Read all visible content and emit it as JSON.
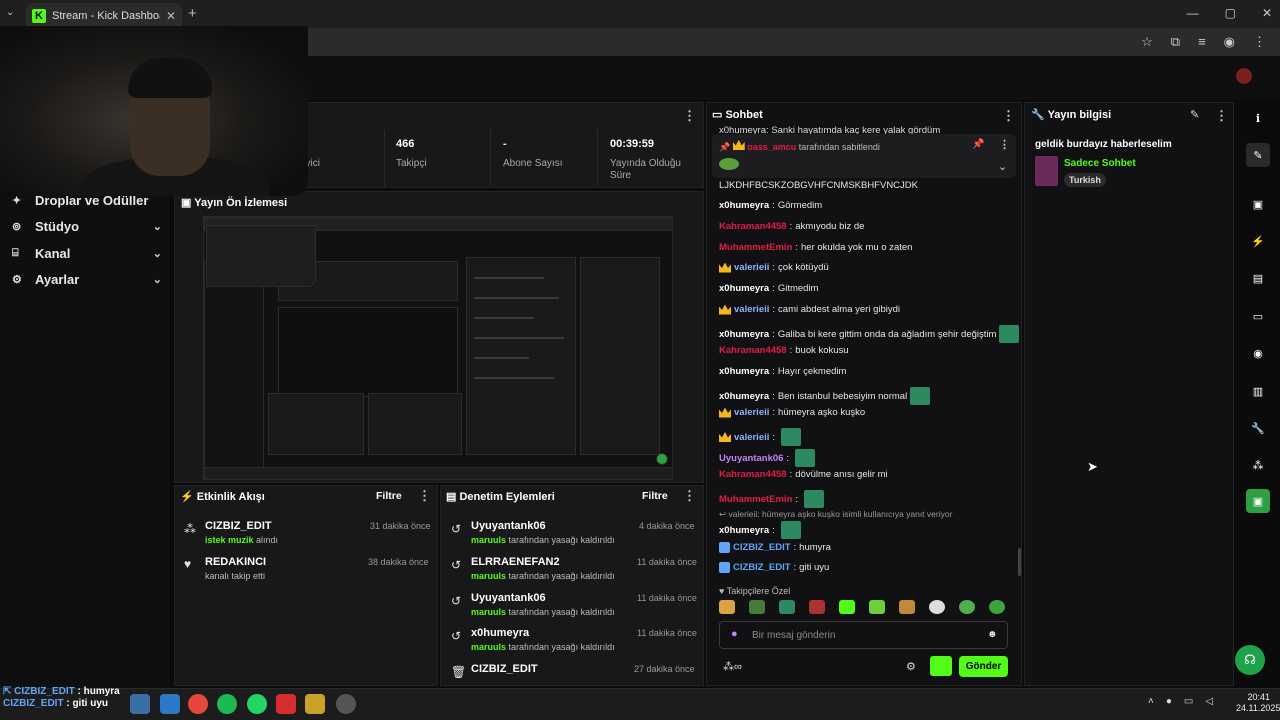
{
  "browser": {
    "tab_title": "Stream - Kick Dashboard",
    "new_tab": "+",
    "close_tab": "✕",
    "window_controls": [
      "—",
      "▢",
      "✕"
    ]
  },
  "sidebar": {
    "items": [
      {
        "label": "Droplar ve Ödüller",
        "icon": "gift-icon"
      },
      {
        "label": "Stüdyo",
        "icon": "studio-icon"
      },
      {
        "label": "Kanal",
        "icon": "channel-icon"
      },
      {
        "label": "Ayarlar",
        "icon": "gear-icon"
      }
    ]
  },
  "stats": {
    "viewers_label": "İzleyici",
    "followers_value": "466",
    "followers_label": "Takipçi",
    "subs_value": "-",
    "subs_label": "Abone Sayısı",
    "uptime_value": "00:39:59",
    "uptime_label": "Yayında Olduğu Süre"
  },
  "preview": {
    "title": "Yayın Ön İzlemesi"
  },
  "activity": {
    "title": "Etkinlik Akışı",
    "filter": "Filtre",
    "items": [
      {
        "name": "CIZBIZ_EDIT",
        "highlight": "istek muzik",
        "rest": " alındı",
        "ago": "31 dakika önce"
      },
      {
        "name": "REDAKINCI",
        "highlight": "",
        "rest": "kanalı takip etti",
        "ago": "38 dakika önce"
      }
    ]
  },
  "moderation": {
    "title": "Denetim Eylemleri",
    "filter": "Filtre",
    "items": [
      {
        "name": "Uyuyantank06",
        "by": "maruuls",
        "action": " tarafından yasağı kaldırıldı",
        "ago": "4 dakika önce"
      },
      {
        "name": "ELRRAENEFAN2",
        "by": "maruuls",
        "action": " tarafından yasağı kaldırıldı",
        "ago": "11 dakika önce"
      },
      {
        "name": "Uyuyantank06",
        "by": "maruuls",
        "action": " tarafından yasağı kaldırıldı",
        "ago": "11 dakika önce"
      },
      {
        "name": "x0humeyra",
        "by": "maruuls",
        "action": " tarafından yasağı kaldırıldı",
        "ago": "11 dakika önce"
      },
      {
        "name": "CIZBIZ_EDIT",
        "by": "",
        "action": "",
        "ago": "27 dakika önce"
      }
    ]
  },
  "chat": {
    "title": "Sohbet",
    "pinned_partial": "x0humeyra: Sanki hayatımda kaç kere yalak gördüm",
    "pinned_by": "oass_amcu",
    "pinned_text": " tarafından sabitlendi",
    "spam_line": "LJKDHFBCSKZOBGVHFCNMSKBHFVNCJDK",
    "messages": [
      {
        "user": "x0humeyra",
        "color": "#ffffff",
        "badge": false,
        "text": "Görmedim",
        "emote": false
      },
      {
        "user": "Kahraman4458",
        "color": "#e11d48",
        "badge": false,
        "text": "akmıyodu biz de",
        "emote": false
      },
      {
        "user": "MuhammetEmin",
        "color": "#e11d48",
        "badge": false,
        "text": "her okulda yok mu o zaten",
        "emote": false
      },
      {
        "user": "valerieii",
        "color": "#8ab4f8",
        "badge": true,
        "text": "çok kötüydü",
        "emote": false
      },
      {
        "user": "x0humeyra",
        "color": "#ffffff",
        "badge": false,
        "text": "Gitmedim",
        "emote": false
      },
      {
        "user": "valerieii",
        "color": "#8ab4f8",
        "badge": true,
        "text": "cami abdest alma yeri gibiydi",
        "emote": false
      },
      {
        "user": "x0humeyra",
        "color": "#ffffff",
        "badge": false,
        "text": "Galiba bi kere gittim onda da ağladım şehir değiştim",
        "emote": true
      },
      {
        "user": "Kahraman4458",
        "color": "#e11d48",
        "badge": false,
        "text": "buok kokusu",
        "emote": false
      },
      {
        "user": "x0humeyra",
        "color": "#ffffff",
        "badge": false,
        "text": "Hayır çekmedim",
        "emote": false
      },
      {
        "user": "x0humeyra",
        "color": "#ffffff",
        "badge": false,
        "text": "Ben istanbul bebesiyim normal",
        "emote": true
      },
      {
        "user": "valerieii",
        "color": "#8ab4f8",
        "badge": true,
        "text": "hümeyra aşko kuşko",
        "emote": false
      },
      {
        "user": "valerieii",
        "color": "#8ab4f8",
        "badge": true,
        "text": "",
        "emote": true
      },
      {
        "user": "Uyuyantank06",
        "color": "#c084fc",
        "badge": false,
        "text": "",
        "emote": true
      },
      {
        "user": "Kahraman4458",
        "color": "#e11d48",
        "badge": false,
        "text": "dövülme anısı gelir mi",
        "emote": false
      },
      {
        "user": "MuhammetEmin",
        "color": "#e11d48",
        "badge": false,
        "text": "",
        "emote": true
      }
    ],
    "reply_hint": "valerieii: hümeyra aşko kuşko isimli kullanıcıya yanıt veriyor",
    "messages2": [
      {
        "user": "x0humeyra",
        "color": "#ffffff",
        "text": ""
      },
      {
        "user": "CIZBIZ_EDIT",
        "color": "#60a5fa",
        "text": "humyra"
      },
      {
        "user": "CIZBIZ_EDIT",
        "color": "#60a5fa",
        "text": "giti uyu"
      }
    ],
    "followers_only": "Takipçilere Özel",
    "input_placeholder": "Bir mesaj gönderin",
    "send": "Gönder"
  },
  "info": {
    "title": "Yayın bilgisi",
    "stream_title": "geldik burdayız haberleselim",
    "category": "Sadece Sohbet",
    "tag": "Turkish"
  },
  "overlay": {
    "line1_user": "CIZBIZ_EDIT",
    "line1_text": " : humyra",
    "line2_user": "CIZBIZ_EDIT",
    "line2_text": " : giti uyu"
  },
  "taskbar": {
    "time": "20:41",
    "date": "24.11.2025"
  },
  "colors": {
    "accent": "#53fc18",
    "panel": "#18181b",
    "bg": "#0b0b0c"
  }
}
